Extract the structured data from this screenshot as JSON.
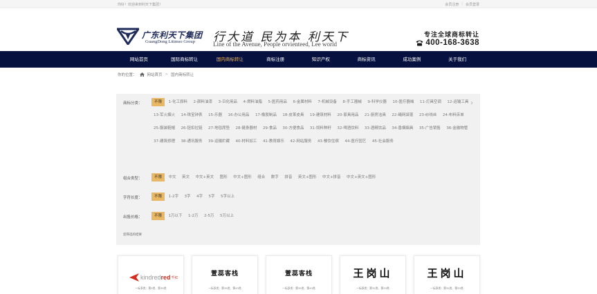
{
  "topbar": {
    "welcome": "你好！欢迎来到利天下集团！",
    "register": "会员注册",
    "separator": "|",
    "login": "会员登录"
  },
  "header": {
    "logo_cn": "广东利天下集团",
    "logo_en": "GuangDong Litimso Group",
    "slogan_cn": "行大道  民为本  利天下",
    "slogan_en": "Line of the Avenue,  People orvienteed,  Lee world",
    "hotline_label": "专注全球商标转让",
    "hotline": "400-168-3638",
    "brand_color": "#1e2a5a"
  },
  "nav": {
    "bg_color": "#06113f",
    "active_color": "#e9b867",
    "items": [
      {
        "label": "网站首页",
        "active": false
      },
      {
        "label": "国际商标转让",
        "active": false
      },
      {
        "label": "国内商标转让",
        "active": true
      },
      {
        "label": "商标注册",
        "active": false
      },
      {
        "label": "知识产权",
        "active": false
      },
      {
        "label": "商标资讯",
        "active": false
      },
      {
        "label": "成功案例",
        "active": false
      },
      {
        "label": "关于我们",
        "active": false
      }
    ]
  },
  "breadcrumb": {
    "label": "你的位置：",
    "home": "网站首页",
    "sep": ">",
    "current": "国内商标转让"
  },
  "filters": {
    "classification": {
      "label": "商标分类：",
      "options": [
        "不限",
        "1-化工原料",
        "2-颜料油漆",
        "3-日化用品",
        "4-燃料油脂",
        "5-医药用品",
        "6-金属材料",
        "7-机械设备",
        "8-手工器械",
        "9-科学仪器",
        "10-医疗器械",
        "11-灯具空调",
        "12-运输工具",
        "13-军火烟火",
        "14-珠宝钟表",
        "15-乐器",
        "16-办公用品",
        "17-橡胶制品",
        "18-皮革皮具",
        "19-建筑材料",
        "20-家具用品",
        "21-厨房洁具",
        "22-绳网袋蓬",
        "23-纱线丝",
        "24-布料床单",
        "25-服装鞋帽",
        "26-钮扣拉链",
        "27-地毯席垫",
        "28-健身器材",
        "29-食品",
        "30-方便食品",
        "31-饲料种籽",
        "32-啤酒饮料",
        "33-酒精饮品",
        "34-香烟烟具",
        "35-广告销售",
        "36-金融物管",
        "37-建筑修理",
        "38-通讯服务",
        "39-运输贮藏",
        "40-材料加工",
        "41-教育娱乐",
        "42-网站服务",
        "43-餐饮住宿",
        "44-医疗园艺",
        "45-社会服务"
      ]
    },
    "combination": {
      "label": "组合类型：",
      "options": [
        "不限",
        "中文",
        "英文",
        "中文+英文",
        "图形",
        "中文+图形",
        "组合",
        "数字",
        "拼音",
        "英文+图形",
        "中文+拼音",
        "中文+英文+图形"
      ]
    },
    "length": {
      "label": "字符长度：",
      "options": [
        "不限",
        "1-2字",
        "3字",
        "4字",
        "5字",
        "5字以上"
      ]
    },
    "price": {
      "label": "出售价格：",
      "options": [
        "不限",
        "1万以下",
        "1-2万",
        "2-5万",
        "5万以上"
      ]
    },
    "selected_color": "#e9b867",
    "result_text": "您筛选的结果"
  },
  "cards": [
    {
      "type": "logo",
      "logo_gray": "kindred",
      "logo_red": "red",
      "logo_cn": "千红",
      "sub": "一标多类：第3类、第35类"
    },
    {
      "type": "text",
      "title": "萱蕊客栈",
      "sub": "一标多类：第35类、第43类"
    },
    {
      "type": "text",
      "title": "萱蕊客栈",
      "sub": "一标多类：第35类、第43类"
    },
    {
      "type": "big",
      "title": "王岗山",
      "sub": "一标多类：第32类、第33类"
    },
    {
      "type": "big",
      "title": "王岗山",
      "sub": "一标多类：第32类、第33类"
    }
  ]
}
